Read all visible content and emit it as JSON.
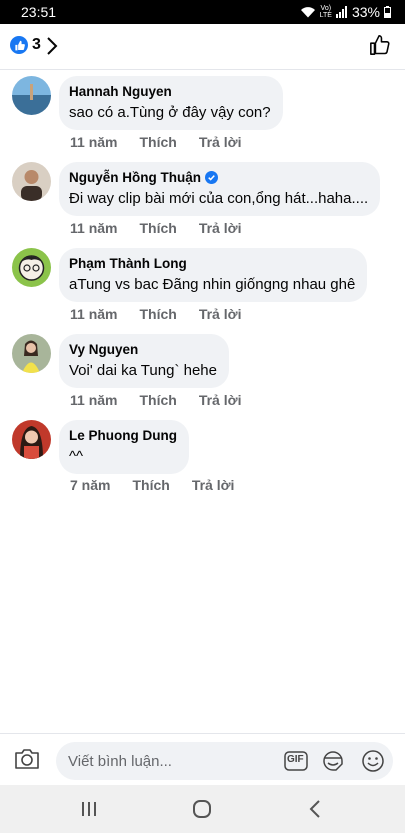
{
  "status_bar": {
    "time": "23:51",
    "battery": "33%",
    "network_top": "Vo)",
    "network_bottom": "LTE"
  },
  "header": {
    "like_count": "3"
  },
  "comments": [
    {
      "author": "Hannah Nguyen",
      "verified": false,
      "text": "sao có a.Tùng ở đây vậy con?",
      "time": "11 năm",
      "like": "Thích",
      "reply": "Trả lời"
    },
    {
      "author": "Nguyễn Hồng Thuận",
      "verified": true,
      "text": "Đi way clip bài mới của con,ổng hát...haha....",
      "time": "11 năm",
      "like": "Thích",
      "reply": "Trả lời"
    },
    {
      "author": "Phạm Thành Long",
      "verified": false,
      "text": "aTung vs bac Đãng nhin giốngng nhau ghê",
      "time": "11 năm",
      "like": "Thích",
      "reply": "Trả lời"
    },
    {
      "author": "Vy Nguyen",
      "verified": false,
      "text": "Voi' dai ka Tung` hehe",
      "time": "11 năm",
      "like": "Thích",
      "reply": "Trả lời"
    },
    {
      "author": "Le Phuong Dung",
      "verified": false,
      "text": "^^",
      "time": "7 năm",
      "like": "Thích",
      "reply": "Trả lời"
    }
  ],
  "composer": {
    "placeholder": "Viết bình luận...",
    "gif_label": "GIF"
  },
  "icons": {
    "like_badge": "thumbs-up-icon",
    "chevron": "chevron-right-icon",
    "like_button": "thumbs-up-outline-icon",
    "camera": "camera-icon",
    "gif": "gif-icon",
    "sticker": "sticker-icon",
    "emoji": "emoji-icon",
    "nav_recents": "recents-icon",
    "nav_home": "home-icon",
    "nav_back": "back-icon"
  },
  "colors": {
    "accent": "#1877f2",
    "bubble": "#f0f2f5",
    "meta_text": "#65676b"
  }
}
